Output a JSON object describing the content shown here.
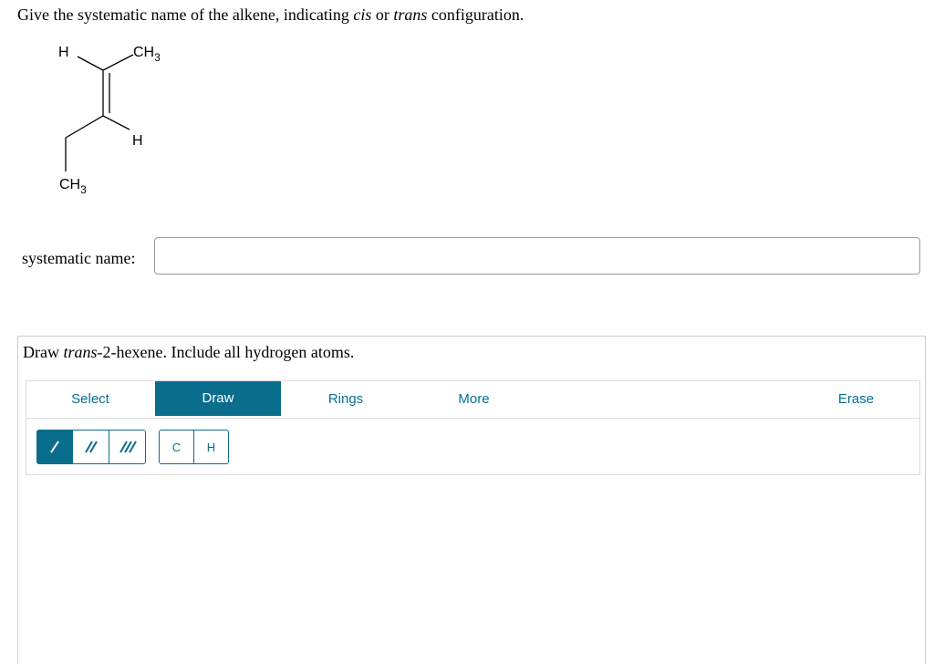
{
  "question1": {
    "text_before": "Give the systematic name of the alkene, indicating ",
    "cis": "cis",
    "or": " or ",
    "trans": "trans",
    "text_after": " configuration."
  },
  "molecule": {
    "top_left_label": "H",
    "top_right_label": "CH",
    "top_right_sub": "3",
    "bottom_right_label": "H",
    "bottom_left_label": "CH",
    "bottom_left_sub": "3"
  },
  "answer": {
    "label": "systematic name:",
    "value": "",
    "placeholder": ""
  },
  "question2": {
    "text_before": "Draw ",
    "italic": "trans",
    "text_after": "-2-hexene. Include all hydrogen atoms."
  },
  "toolbar": {
    "tabs": [
      "Select",
      "Draw",
      "Rings",
      "More",
      "Erase"
    ],
    "active_tab": "Draw",
    "bond_tools": [
      "single-bond",
      "double-bond",
      "triple-bond"
    ],
    "atoms": [
      "C",
      "H"
    ]
  },
  "colors": {
    "accent": "#0a6d8b",
    "tab_text": "#0a6f90"
  }
}
